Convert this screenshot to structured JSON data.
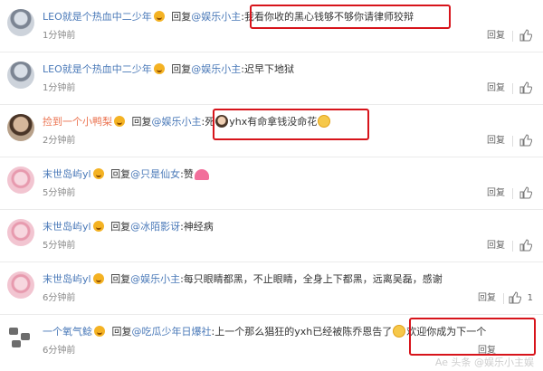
{
  "comments": [
    {
      "username": "LEO就是个热血中二少年",
      "reply_word": "回复",
      "target": "@娱乐小主",
      "text": ":我看你收的黑心钱够不够你请律师狡辩",
      "time": "1分钟前",
      "reply_label": "回复",
      "avatar_icon": "leo-avatar"
    },
    {
      "username": "LEO就是个热血中二少年",
      "reply_word": "回复",
      "target": "@娱乐小主",
      "text": ":迟早下地狱",
      "time": "1分钟前",
      "reply_label": "回复",
      "avatar_icon": "leo-avatar"
    },
    {
      "username": "捡到一个小鸭梨",
      "reply_word": "回复",
      "target": "@娱乐小主",
      "text_before": ":死",
      "text_after": "yhx有命拿钱没命花",
      "time": "2分钟前",
      "reply_label": "回复",
      "avatar_icon": "pear-avatar"
    },
    {
      "username": "末世岛屿yl",
      "reply_word": "回复",
      "target": "@只是仙女",
      "text": ":赞",
      "time": "5分钟前",
      "reply_label": "回复",
      "avatar_icon": "pink-avatar"
    },
    {
      "username": "末世岛屿yl",
      "reply_word": "回复",
      "target": "@冰陌影讶",
      "text": ":神经病",
      "time": "5分钟前",
      "reply_label": "回复",
      "avatar_icon": "pink-avatar"
    },
    {
      "username": "末世岛屿yl",
      "reply_word": "回复",
      "target": "@娱乐小主",
      "text": ":每只眼睛都黑，不止眼睛，全身上下都黑，远离吴磊，感谢",
      "time": "6分钟前",
      "reply_label": "回复",
      "like_count": "1",
      "avatar_icon": "pink-avatar"
    },
    {
      "username": "一个氧气鲶",
      "reply_word": "回复",
      "target": "@吃瓜少年日爆社",
      "text_before": ":上一个那么猖狂的yxh已经被陈乔恩告了",
      "text_after": "欢迎你成为下一个",
      "time": "6分钟前",
      "reply_label": "回复",
      "avatar_icon": "oxygen-avatar"
    }
  ],
  "watermark": "Ae 头条 @娱乐小主娱"
}
